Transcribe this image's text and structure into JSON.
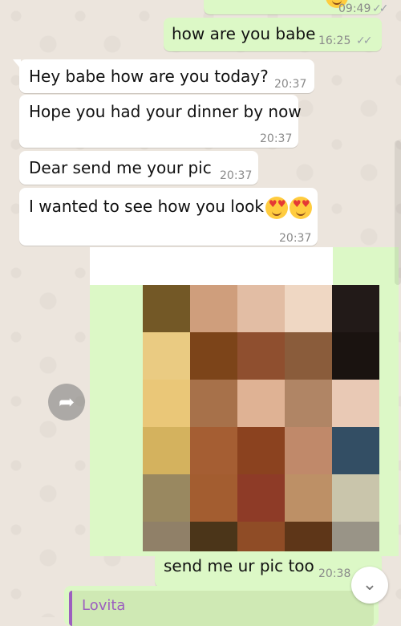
{
  "messages": [
    {
      "id": "m0",
      "side": "out",
      "text": "",
      "time": "09:49",
      "ticks": "✓✓"
    },
    {
      "id": "m1",
      "side": "out",
      "text": "how are you babe",
      "time": "16:25",
      "ticks": "✓✓"
    },
    {
      "id": "m2",
      "side": "in",
      "text": "Hey babe how are you today?",
      "time": "20:37"
    },
    {
      "id": "m3",
      "side": "in",
      "text": "Hope you had your dinner by now",
      "time": "20:37"
    },
    {
      "id": "m4",
      "side": "in",
      "text": "Dear send me your pic",
      "time": "20:37"
    },
    {
      "id": "m5",
      "side": "in",
      "text": "I wanted to see how you look",
      "time": "20:37",
      "emoji": [
        "heart-eyes",
        "heart-eyes"
      ]
    },
    {
      "id": "m6",
      "side": "out",
      "kind": "image",
      "caption": "send me ur pic too",
      "time": "20:38",
      "ticks": "✓✓"
    }
  ],
  "quoted_reply": {
    "author": "Lovita"
  },
  "controls": {
    "forward_icon": "➦",
    "scroll_down_icon": "⌄"
  },
  "colors": {
    "incoming": "#ffffff",
    "outgoing": "#dcf8c6",
    "background": "#ece5dd",
    "quote_author": "#9c5fbf",
    "pixel_grid": [
      [
        "#735826",
        "#cf9e7c",
        "#e2bda4",
        "#efd7c3",
        "#221a18"
      ],
      [
        "#eacb82",
        "#7c4419",
        "#8f4f2f",
        "#8a5c3b",
        "#1a1310"
      ],
      [
        "#eac778",
        "#a7714a",
        "#dfb294",
        "#b08565",
        "#e9c9b5"
      ],
      [
        "#d4b25e",
        "#a55e33",
        "#8b421f",
        "#c0896a",
        "#334e64"
      ],
      [
        "#998860",
        "#a35d30",
        "#8e3b27",
        "#bd9066",
        "#c9c5ab"
      ],
      [
        "#908068",
        "#4b3519",
        "#8f4c26",
        "#5e3618",
        "#999487"
      ]
    ]
  }
}
